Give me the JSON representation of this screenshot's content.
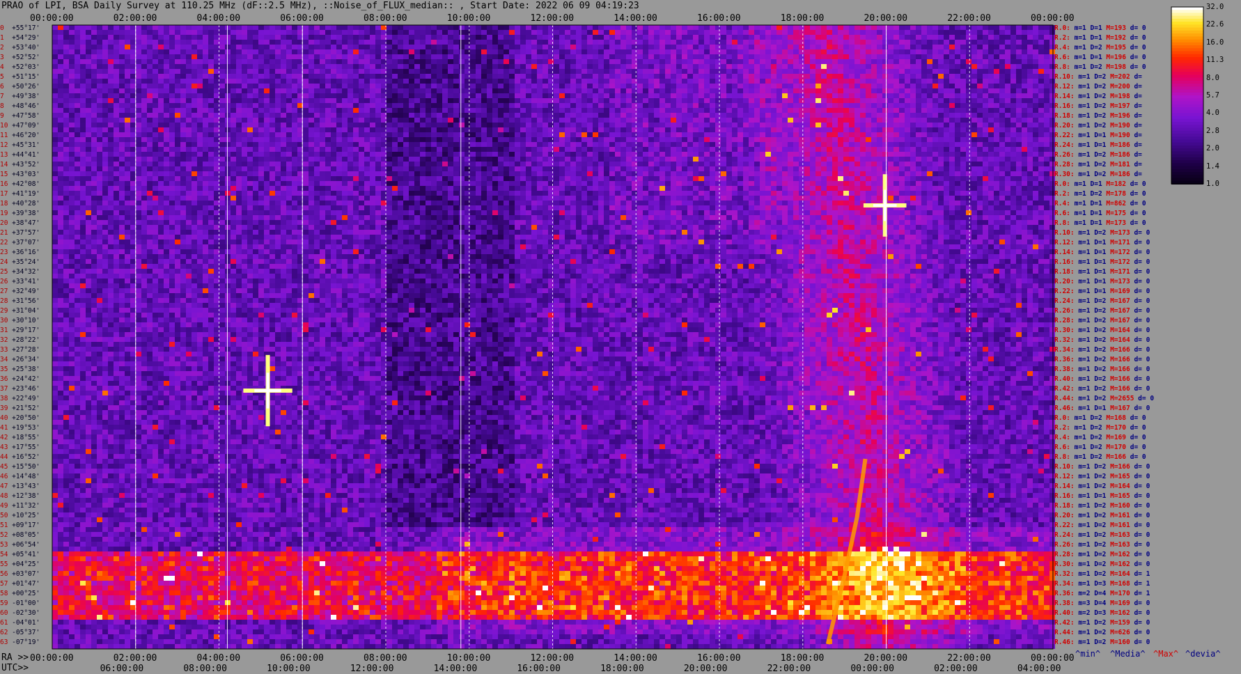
{
  "title": "PRAO of LPI, BSA Daily Survey at 110.25 MHz (dF::2.5 MHz), ::Noise_of_FLUX_median:: , Start Date: 2022 06 09 04:19:23",
  "top_axis": [
    "00:00:00",
    "02:00:00",
    "04:00:00",
    "06:00:00",
    "08:00:00",
    "10:00:00",
    "12:00:00",
    "14:00:00",
    "16:00:00",
    "18:00:00",
    "20:00:00",
    "22:00:00",
    "00:00:00"
  ],
  "bottom_axis_ra_prefix": "RA >>",
  "bottom_axis_ra": [
    "00:00:00",
    "02:00:00",
    "04:00:00",
    "06:00:00",
    "08:00:00",
    "10:00:00",
    "12:00:00",
    "14:00:00",
    "16:00:00",
    "18:00:00",
    "20:00:00",
    "22:00:00",
    "00:00:00"
  ],
  "bottom_axis_utc_prefix": "UTC>>",
  "bottom_axis_utc": [
    "06:00:00",
    "08:00:00",
    "10:00:00",
    "12:00:00",
    "14:00:00",
    "16:00:00",
    "18:00:00",
    "20:00:00",
    "22:00:00",
    "00:00:00",
    "02:00:00",
    "04:00:00"
  ],
  "declinations": [
    {
      "idx": "0",
      "dec": "+55°17'"
    },
    {
      "idx": "1",
      "dec": "+54°29'"
    },
    {
      "idx": "2",
      "dec": "+53°40'"
    },
    {
      "idx": "3",
      "dec": "+52°52'"
    },
    {
      "idx": "4",
      "dec": "+52°03'"
    },
    {
      "idx": "5",
      "dec": "+51°15'"
    },
    {
      "idx": "6",
      "dec": "+50°26'"
    },
    {
      "idx": "7",
      "dec": "+49°38'"
    },
    {
      "idx": "8",
      "dec": "+48°46'"
    },
    {
      "idx": "9",
      "dec": "+47°58'"
    },
    {
      "idx": "10",
      "dec": "+47°09'"
    },
    {
      "idx": "11",
      "dec": "+46°20'"
    },
    {
      "idx": "12",
      "dec": "+45°31'"
    },
    {
      "idx": "13",
      "dec": "+44°41'"
    },
    {
      "idx": "14",
      "dec": "+43°52'"
    },
    {
      "idx": "15",
      "dec": "+43°03'"
    },
    {
      "idx": "16",
      "dec": "+42°08'"
    },
    {
      "idx": "17",
      "dec": "+41°19'"
    },
    {
      "idx": "18",
      "dec": "+40°28'"
    },
    {
      "idx": "19",
      "dec": "+39°38'"
    },
    {
      "idx": "20",
      "dec": "+38°47'"
    },
    {
      "idx": "21",
      "dec": "+37°57'"
    },
    {
      "idx": "22",
      "dec": "+37°07'"
    },
    {
      "idx": "23",
      "dec": "+36°16'"
    },
    {
      "idx": "24",
      "dec": "+35°24'"
    },
    {
      "idx": "25",
      "dec": "+34°32'"
    },
    {
      "idx": "26",
      "dec": "+33°41'"
    },
    {
      "idx": "27",
      "dec": "+32°49'"
    },
    {
      "idx": "28",
      "dec": "+31°56'"
    },
    {
      "idx": "29",
      "dec": "+31°04'"
    },
    {
      "idx": "30",
      "dec": "+30°10'"
    },
    {
      "idx": "31",
      "dec": "+29°17'"
    },
    {
      "idx": "32",
      "dec": "+28°22'"
    },
    {
      "idx": "33",
      "dec": "+27°28'"
    },
    {
      "idx": "34",
      "dec": "+26°34'"
    },
    {
      "idx": "35",
      "dec": "+25°38'"
    },
    {
      "idx": "36",
      "dec": "+24°42'"
    },
    {
      "idx": "37",
      "dec": "+23°46'"
    },
    {
      "idx": "38",
      "dec": "+22°49'"
    },
    {
      "idx": "39",
      "dec": "+21°52'"
    },
    {
      "idx": "40",
      "dec": "+20°50'"
    },
    {
      "idx": "41",
      "dec": "+19°53'"
    },
    {
      "idx": "42",
      "dec": "+18°55'"
    },
    {
      "idx": "43",
      "dec": "+17°55'"
    },
    {
      "idx": "44",
      "dec": "+16°52'"
    },
    {
      "idx": "45",
      "dec": "+15°50'"
    },
    {
      "idx": "46",
      "dec": "+14°48'"
    },
    {
      "idx": "47",
      "dec": "+13°43'"
    },
    {
      "idx": "48",
      "dec": "+12°38'"
    },
    {
      "idx": "49",
      "dec": "+11°32'"
    },
    {
      "idx": "50",
      "dec": "+10°25'"
    },
    {
      "idx": "51",
      "dec": "+09°17'"
    },
    {
      "idx": "52",
      "dec": "+08°05'"
    },
    {
      "idx": "53",
      "dec": "+06°54'"
    },
    {
      "idx": "54",
      "dec": "+05°41'"
    },
    {
      "idx": "55",
      "dec": "+04°25'"
    },
    {
      "idx": "56",
      "dec": "+03°07'"
    },
    {
      "idx": "57",
      "dec": "+01°47'"
    },
    {
      "idx": "58",
      "dec": "+00°25'"
    },
    {
      "idx": "59",
      "dec": "-01°00'"
    },
    {
      "idx": "60",
      "dec": "-02°30'"
    },
    {
      "idx": "61",
      "dec": "-04°01'"
    },
    {
      "idx": "62",
      "dec": "-05°37'"
    },
    {
      "idx": "63",
      "dec": "-07°19'"
    }
  ],
  "stats": [
    {
      "r": "R.0:",
      "m": "m=1",
      "D": "D=1",
      "M": "M=193",
      "d": "d= 0"
    },
    {
      "r": "R.2:",
      "m": "m=1",
      "D": "D=1",
      "M": "M=192",
      "d": "d= 0"
    },
    {
      "r": "R.4:",
      "m": "m=1",
      "D": "D=2",
      "M": "M=195",
      "d": "d= 0"
    },
    {
      "r": "R.6:",
      "m": "m=1",
      "D": "D=1",
      "M": "M=196",
      "d": "d= 0"
    },
    {
      "r": "R.8:",
      "m": "m=1",
      "D": "D=2",
      "M": "M=198",
      "d": "d= 0"
    },
    {
      "r": "R.10:",
      "m": "m=1",
      "D": "D=2",
      "M": "M=202",
      "d": "d="
    },
    {
      "r": "R.12:",
      "m": "m=1",
      "D": "D=2",
      "M": "M=200",
      "d": "d="
    },
    {
      "r": "R.14:",
      "m": "m=1",
      "D": "D=2",
      "M": "M=198",
      "d": "d="
    },
    {
      "r": "R.16:",
      "m": "m=1",
      "D": "D=2",
      "M": "M=197",
      "d": "d="
    },
    {
      "r": "R.18:",
      "m": "m=1",
      "D": "D=2",
      "M": "M=196",
      "d": "d="
    },
    {
      "r": "R.20:",
      "m": "m=1",
      "D": "D=2",
      "M": "M=190",
      "d": "d="
    },
    {
      "r": "R.22:",
      "m": "m=1",
      "D": "D=1",
      "M": "M=190",
      "d": "d="
    },
    {
      "r": "R.24:",
      "m": "m=1",
      "D": "D=1",
      "M": "M=186",
      "d": "d="
    },
    {
      "r": "R.26:",
      "m": "m=1",
      "D": "D=2",
      "M": "M=186",
      "d": "d="
    },
    {
      "r": "R.28:",
      "m": "m=1",
      "D": "D=2",
      "M": "M=181",
      "d": "d="
    },
    {
      "r": "R.30:",
      "m": "m=1",
      "D": "D=2",
      "M": "M=186",
      "d": "d="
    },
    {
      "r": "R.0:",
      "m": "m=1",
      "D": "D=1",
      "M": "M=182",
      "d": "d= 0"
    },
    {
      "r": "R.2:",
      "m": "m=1",
      "D": "D=2",
      "M": "M=178",
      "d": "d= 0"
    },
    {
      "r": "R.4:",
      "m": "m=1",
      "D": "D=1",
      "M": "M=862",
      "d": "d= 0"
    },
    {
      "r": "R.6:",
      "m": "m=1",
      "D": "D=1",
      "M": "M=175",
      "d": "d= 0"
    },
    {
      "r": "R.8:",
      "m": "m=1",
      "D": "D=1",
      "M": "M=173",
      "d": "d= 0"
    },
    {
      "r": "R.10:",
      "m": "m=1",
      "D": "D=2",
      "M": "M=173",
      "d": "d= 0"
    },
    {
      "r": "R.12:",
      "m": "m=1",
      "D": "D=1",
      "M": "M=171",
      "d": "d= 0"
    },
    {
      "r": "R.14:",
      "m": "m=1",
      "D": "D=1",
      "M": "M=172",
      "d": "d= 0"
    },
    {
      "r": "R.16:",
      "m": "m=1",
      "D": "D=1",
      "M": "M=172",
      "d": "d= 0"
    },
    {
      "r": "R.18:",
      "m": "m=1",
      "D": "D=1",
      "M": "M=171",
      "d": "d= 0"
    },
    {
      "r": "R.20:",
      "m": "m=1",
      "D": "D=1",
      "M": "M=173",
      "d": "d= 0"
    },
    {
      "r": "R.22:",
      "m": "m=1",
      "D": "D=1",
      "M": "M=169",
      "d": "d= 0"
    },
    {
      "r": "R.24:",
      "m": "m=1",
      "D": "D=2",
      "M": "M=167",
      "d": "d= 0"
    },
    {
      "r": "R.26:",
      "m": "m=1",
      "D": "D=2",
      "M": "M=167",
      "d": "d= 0"
    },
    {
      "r": "R.28:",
      "m": "m=1",
      "D": "D=2",
      "M": "M=167",
      "d": "d= 0"
    },
    {
      "r": "R.30:",
      "m": "m=1",
      "D": "D=2",
      "M": "M=164",
      "d": "d= 0"
    },
    {
      "r": "R.32:",
      "m": "m=1",
      "D": "D=2",
      "M": "M=164",
      "d": "d= 0"
    },
    {
      "r": "R.34:",
      "m": "m=1",
      "D": "D=2",
      "M": "M=166",
      "d": "d= 0"
    },
    {
      "r": "R.36:",
      "m": "m=1",
      "D": "D=2",
      "M": "M=166",
      "d": "d= 0"
    },
    {
      "r": "R.38:",
      "m": "m=1",
      "D": "D=2",
      "M": "M=166",
      "d": "d= 0"
    },
    {
      "r": "R.40:",
      "m": "m=1",
      "D": "D=2",
      "M": "M=166",
      "d": "d= 0"
    },
    {
      "r": "R.42:",
      "m": "m=1",
      "D": "D=2",
      "M": "M=166",
      "d": "d= 0"
    },
    {
      "r": "R.44:",
      "m": "m=1",
      "D": "D=2",
      "M": "M=2655",
      "d": "d= 0"
    },
    {
      "r": "R.46:",
      "m": "m=1",
      "D": "D=1",
      "M": "M=167",
      "d": "d= 0"
    },
    {
      "r": "R.0:",
      "m": "m=1",
      "D": "D=2",
      "M": "M=168",
      "d": "d= 0"
    },
    {
      "r": "R.2:",
      "m": "m=1",
      "D": "D=2",
      "M": "M=170",
      "d": "d= 0"
    },
    {
      "r": "R.4:",
      "m": "m=1",
      "D": "D=2",
      "M": "M=169",
      "d": "d= 0"
    },
    {
      "r": "R.6:",
      "m": "m=1",
      "D": "D=2",
      "M": "M=170",
      "d": "d= 0"
    },
    {
      "r": "R.8:",
      "m": "m=1",
      "D": "D=2",
      "M": "M=166",
      "d": "d= 0"
    },
    {
      "r": "R.10:",
      "m": "m=1",
      "D": "D=2",
      "M": "M=166",
      "d": "d= 0"
    },
    {
      "r": "R.12:",
      "m": "m=1",
      "D": "D=2",
      "M": "M=165",
      "d": "d= 0"
    },
    {
      "r": "R.14:",
      "m": "m=1",
      "D": "D=2",
      "M": "M=164",
      "d": "d= 0"
    },
    {
      "r": "R.16:",
      "m": "m=1",
      "D": "D=1",
      "M": "M=165",
      "d": "d= 0"
    },
    {
      "r": "R.18:",
      "m": "m=1",
      "D": "D=2",
      "M": "M=160",
      "d": "d= 0"
    },
    {
      "r": "R.20:",
      "m": "m=1",
      "D": "D=2",
      "M": "M=161",
      "d": "d= 0"
    },
    {
      "r": "R.22:",
      "m": "m=1",
      "D": "D=2",
      "M": "M=161",
      "d": "d= 0"
    },
    {
      "r": "R.24:",
      "m": "m=1",
      "D": "D=2",
      "M": "M=163",
      "d": "d= 0"
    },
    {
      "r": "R.26:",
      "m": "m=1",
      "D": "D=2",
      "M": "M=163",
      "d": "d= 0"
    },
    {
      "r": "R.28:",
      "m": "m=1",
      "D": "D=2",
      "M": "M=162",
      "d": "d= 0"
    },
    {
      "r": "R.30:",
      "m": "m=1",
      "D": "D=2",
      "M": "M=162",
      "d": "d= 0"
    },
    {
      "r": "R.32:",
      "m": "m=1",
      "D": "D=2",
      "M": "M=164",
      "d": "d= 1"
    },
    {
      "r": "R.34:",
      "m": "m=1",
      "D": "D=3",
      "M": "M=168",
      "d": "d= 1"
    },
    {
      "r": "R.36:",
      "m": "m=2",
      "D": "D=4",
      "M": "M=170",
      "d": "d= 1"
    },
    {
      "r": "R.38:",
      "m": "m=3",
      "D": "D=4",
      "M": "M=169",
      "d": "d= 0"
    },
    {
      "r": "R.40:",
      "m": "m=2",
      "D": "D=3",
      "M": "M=162",
      "d": "d= 0"
    },
    {
      "r": "R.42:",
      "m": "m=1",
      "D": "D=2",
      "M": "M=159",
      "d": "d= 0"
    },
    {
      "r": "R.44:",
      "m": "m=1",
      "D": "D=2",
      "M": "M=626",
      "d": "d= 0"
    },
    {
      "r": "R.46:",
      "m": "m=1",
      "D": "D=2",
      "M": "M=160",
      "d": "d= 0"
    }
  ],
  "legend_footer": {
    "min": "^min^",
    "media": "^Media^",
    "max": "^Max^",
    "devia": "^devia^"
  },
  "colorbar": {
    "ticks": [
      "32.0",
      "22.6",
      "16.0",
      "11.3",
      "8.0",
      "5.7",
      "4.0",
      "2.8",
      "2.0",
      "1.4",
      "1.0"
    ],
    "colors": [
      "#ffffff",
      "#ffff60",
      "#ffd000",
      "#ff8000",
      "#ff2000",
      "#e0003c",
      "#c0009a",
      "#9c1ee0",
      "#6a10c0",
      "#2a0070",
      "#000010"
    ]
  },
  "colors": {
    "background": "#999999",
    "plot_bg": "#0a0018",
    "red_text": "#d00000",
    "blue_text": "#000080"
  },
  "chart_data": {
    "type": "heatmap",
    "title": "PRAO of LPI, BSA Daily Survey at 110.25 MHz (dF::2.5 MHz), ::Noise_of_FLUX_median:: , Start Date: 2022 06 09 04:19:23",
    "x_axis": "RA 00:00:00 to 24:00:00 (UTC 04:19 to 04:19 next day)",
    "y_axis": "Declination +55°17' to -07°19' (64 beams)",
    "color_scale": "log, 1.0 to 32.0",
    "features": [
      {
        "name": "bright point source",
        "ra": "05:10",
        "dec": "+23°46'",
        "level": 32.0
      },
      {
        "name": "bright point source",
        "ra": "19:58",
        "dec": "+40°28'",
        "level": 32.0
      },
      {
        "name": "galactic plane ridge",
        "ra": "19:00-20:30",
        "dec": "-05° to +45°",
        "level": 8.0
      },
      {
        "name": "equatorial interference band",
        "ra": "00:00-24:00",
        "dec": "-02° to +02°",
        "level": 5.7
      }
    ]
  }
}
